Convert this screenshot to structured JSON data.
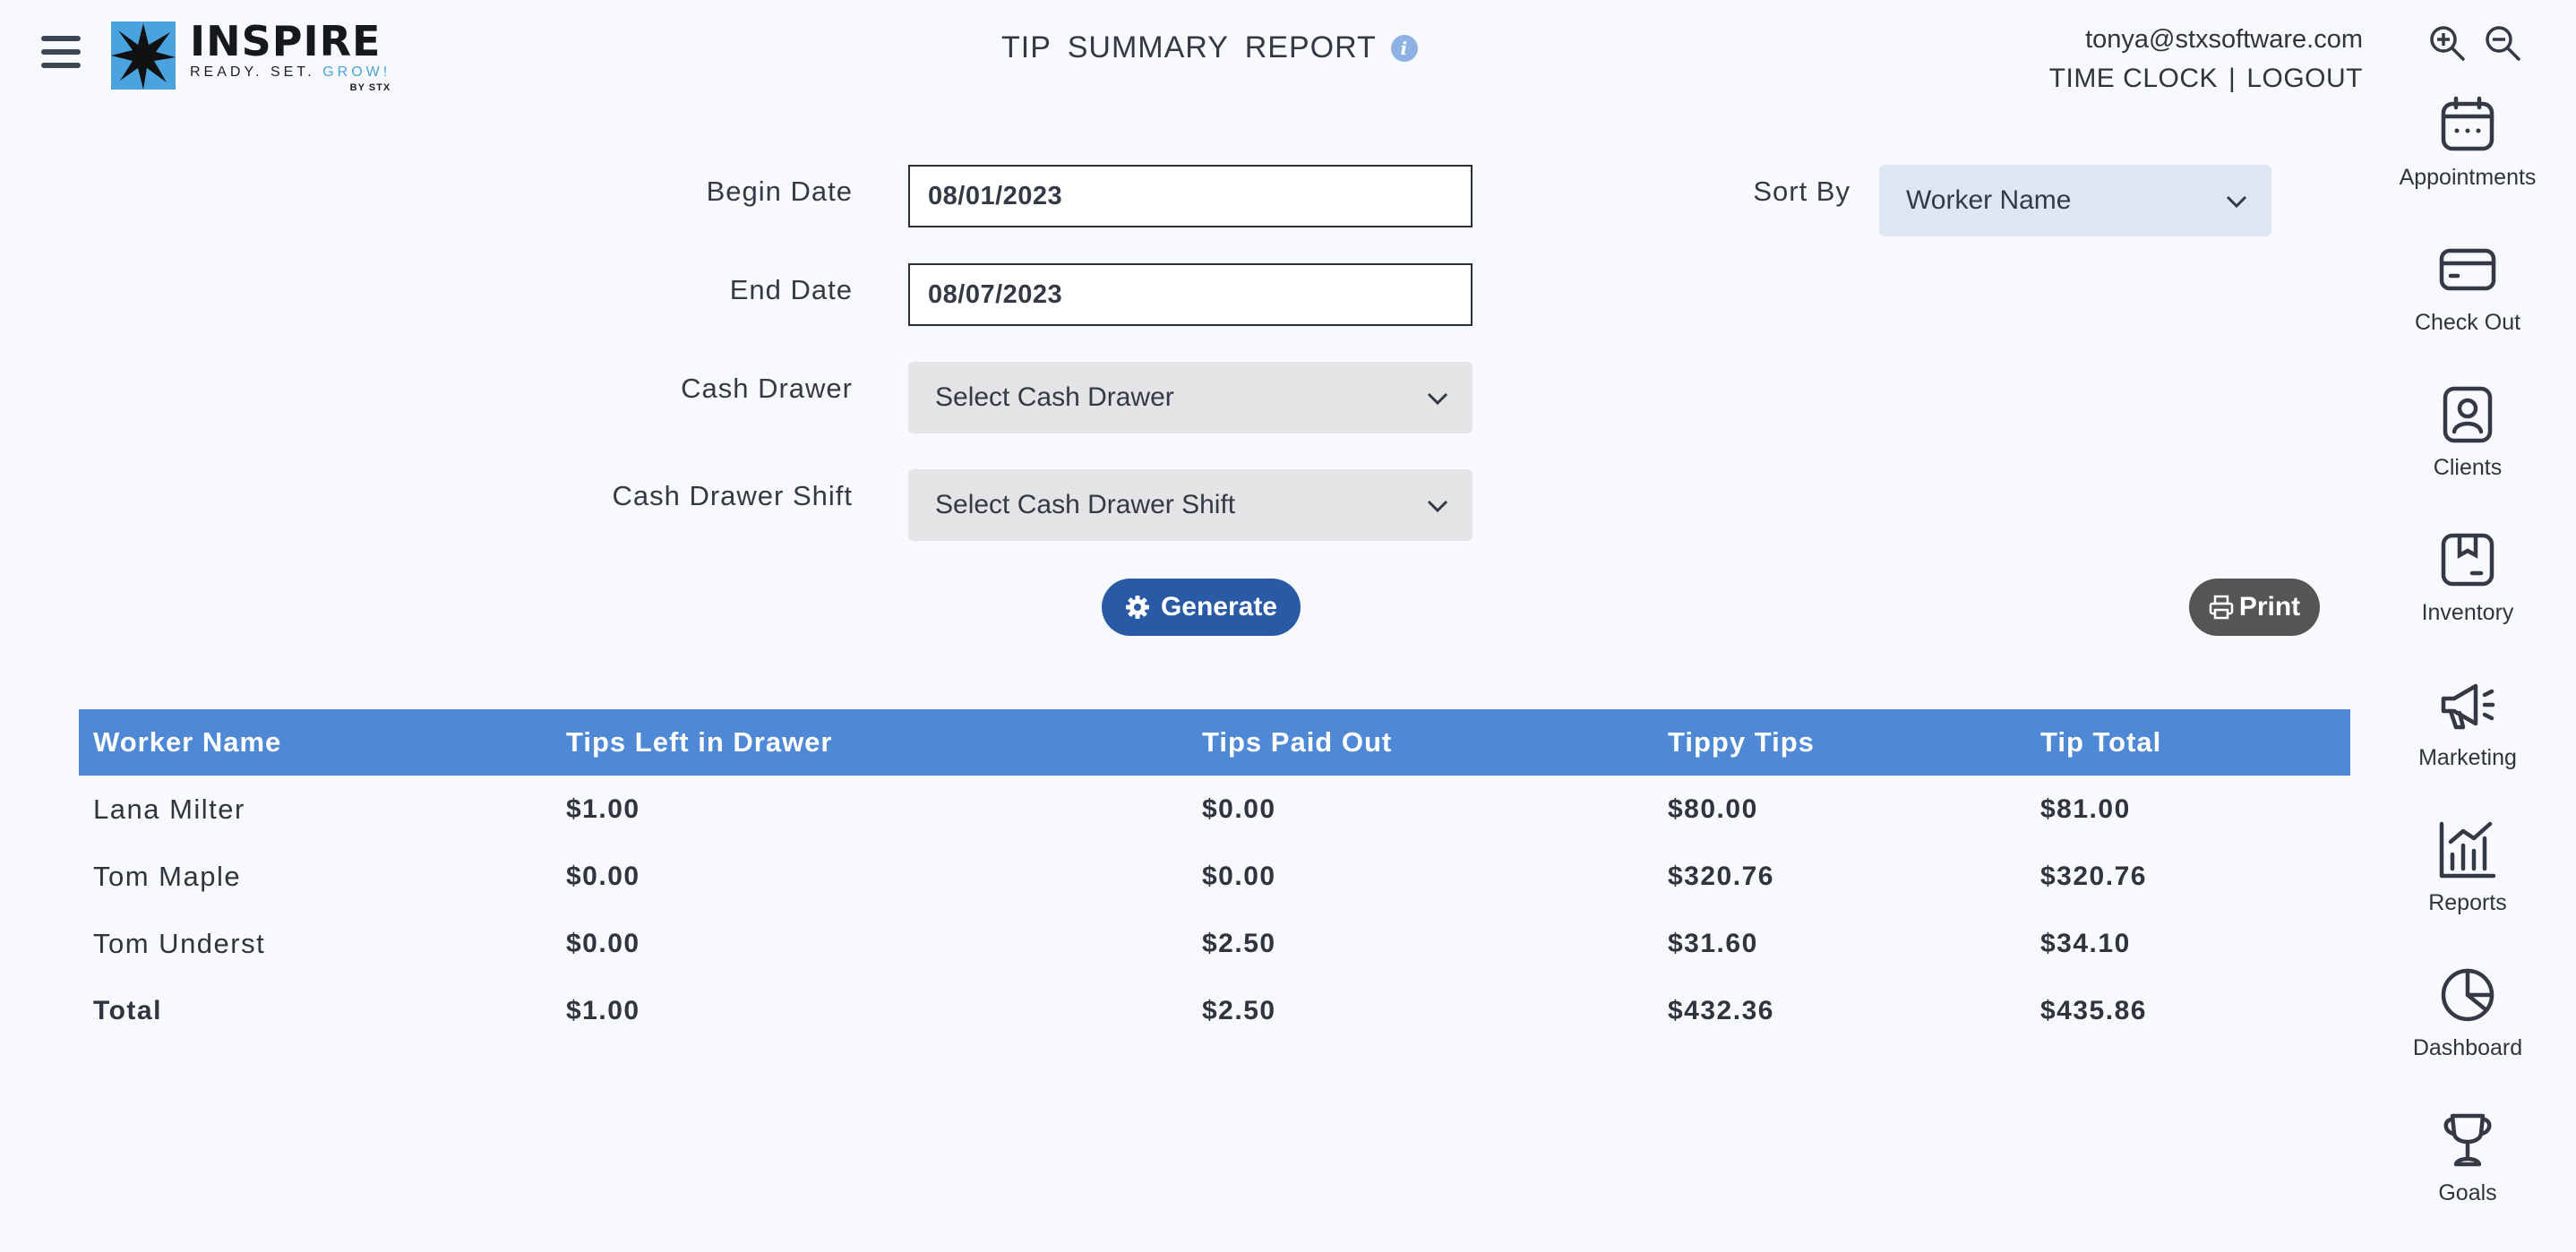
{
  "header": {
    "logo": {
      "title": "INSPIRE",
      "tag_prefix": "READY. SET.",
      "tag_grow": "GROW!",
      "by": "BY STX"
    },
    "title": "TIP SUMMARY REPORT",
    "user_email": "tonya@stxsoftware.com",
    "time_clock": "TIME CLOCK",
    "separator": "|",
    "logout": "LOGOUT"
  },
  "form": {
    "begin_date": {
      "label": "Begin Date",
      "value": "08/01/2023"
    },
    "end_date": {
      "label": "End Date",
      "value": "08/07/2023"
    },
    "cash_drawer": {
      "label": "Cash Drawer",
      "value": "Select Cash Drawer"
    },
    "cash_drawer_shift": {
      "label": "Cash Drawer Shift",
      "value": "Select Cash Drawer Shift"
    },
    "sort_by": {
      "label": "Sort By",
      "value": "Worker Name"
    },
    "generate_label": "Generate",
    "print_label": "Print"
  },
  "table": {
    "headers": [
      "Worker Name",
      "Tips Left in Drawer",
      "Tips Paid Out",
      "Tippy Tips",
      "Tip Total"
    ],
    "rows": [
      [
        "Lana Milter",
        "$1.00",
        "$0.00",
        "$80.00",
        "$81.00"
      ],
      [
        "Tom Maple",
        "$0.00",
        "$0.00",
        "$320.76",
        "$320.76"
      ],
      [
        "Tom Underst",
        "$0.00",
        "$2.50",
        "$31.60",
        "$34.10"
      ]
    ],
    "total": [
      "Total",
      "$1.00",
      "$2.50",
      "$432.36",
      "$435.86"
    ]
  },
  "sidebar": {
    "items": [
      {
        "label": "Appointments",
        "icon": "calendar-icon"
      },
      {
        "label": "Check Out",
        "icon": "credit-card-icon"
      },
      {
        "label": "Clients",
        "icon": "client-icon"
      },
      {
        "label": "Inventory",
        "icon": "box-icon"
      },
      {
        "label": "Marketing",
        "icon": "megaphone-icon"
      },
      {
        "label": "Reports",
        "icon": "chart-icon"
      },
      {
        "label": "Dashboard",
        "icon": "pie-chart-icon"
      },
      {
        "label": "Goals",
        "icon": "trophy-icon"
      }
    ]
  },
  "colors": {
    "accent": "#4f89d6",
    "generate": "#2a5aa6",
    "print": "#555555",
    "logo_blue": "#4aa3df"
  }
}
